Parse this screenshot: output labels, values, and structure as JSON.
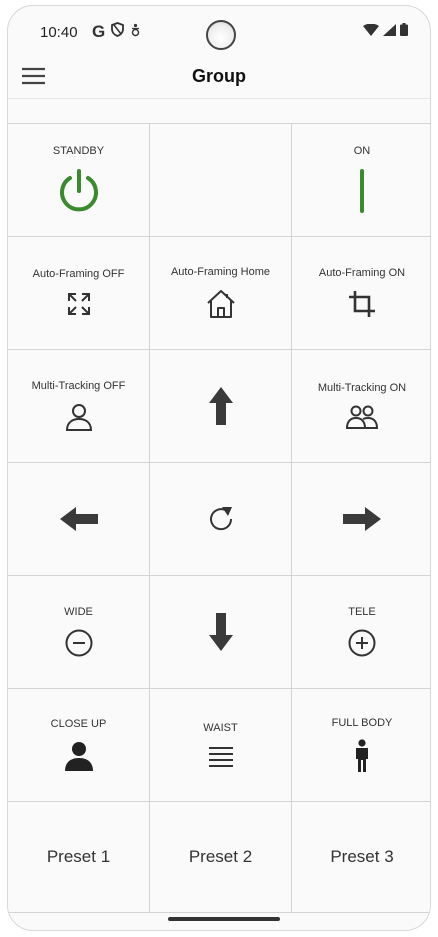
{
  "status_bar": {
    "time": "10:40",
    "g_letter": "G"
  },
  "app_bar": {
    "title": "Group"
  },
  "colors": {
    "power_green": "#3a8a2e",
    "icon_dark": "#333333"
  },
  "grid": {
    "standby": "STANDBY",
    "on": "ON",
    "af_off": "Auto-Framing OFF",
    "af_home": "Auto-Framing Home",
    "af_on": "Auto-Framing ON",
    "mt_off": "Multi-Tracking OFF",
    "mt_on": "Multi-Tracking ON",
    "wide": "WIDE",
    "tele": "TELE",
    "close_up": "CLOSE UP",
    "waist": "WAIST",
    "full_body": "FULL BODY",
    "preset1": "Preset 1",
    "preset2": "Preset 2",
    "preset3": "Preset 3"
  },
  "icons": [
    "power-icon",
    "on-line-icon",
    "expand-icon",
    "home-icon",
    "crop-icon",
    "person-outline-icon",
    "arrow-up-icon",
    "group-icon",
    "arrow-left-icon",
    "refresh-icon",
    "arrow-right-icon",
    "zoom-out-icon",
    "arrow-down-icon",
    "zoom-in-icon",
    "person-icon",
    "lines-icon",
    "standing-person-icon"
  ]
}
